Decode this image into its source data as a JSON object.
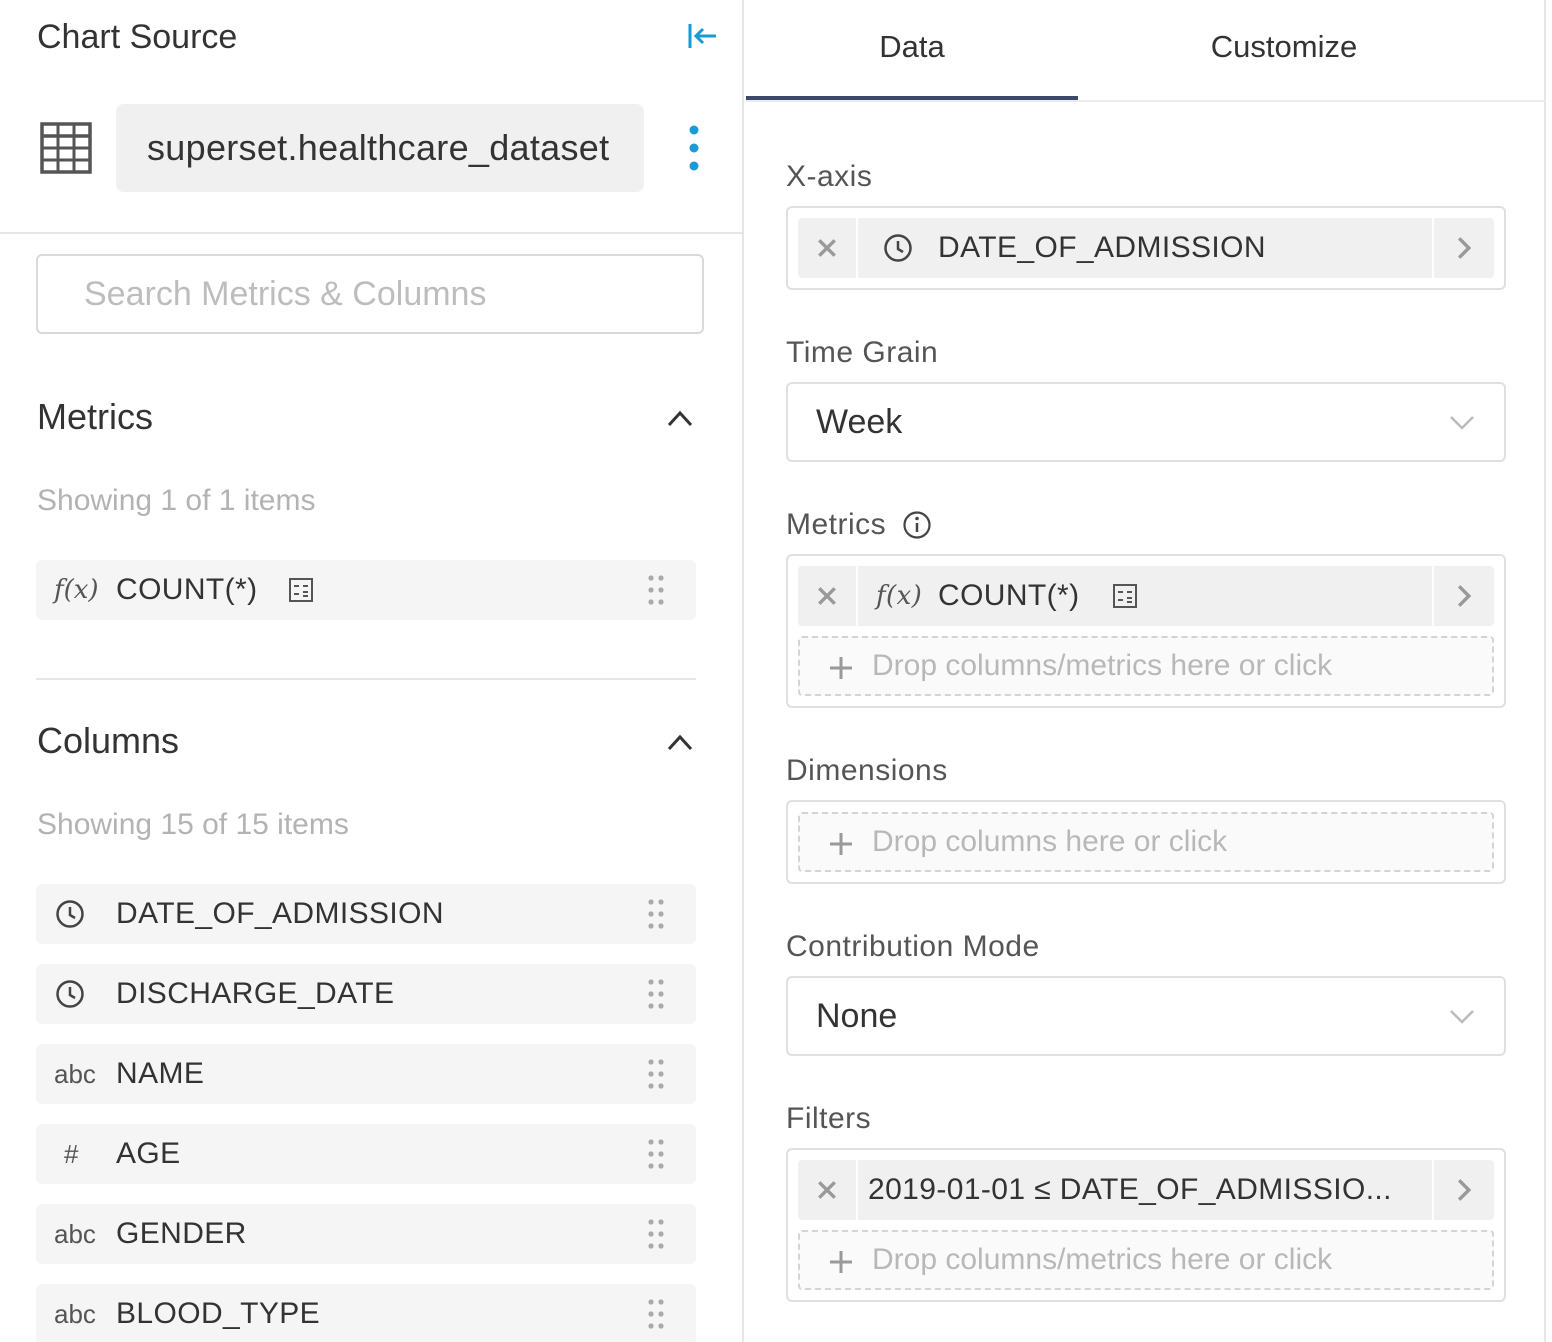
{
  "chart_source": {
    "title": "Chart Source",
    "dataset_name": "superset.healthcare_dataset",
    "search": {
      "placeholder": "Search Metrics & Columns",
      "value": ""
    },
    "metrics": {
      "title": "Metrics",
      "showing": "Showing 1 of 1 items",
      "items": [
        {
          "type_icon": "function-icon",
          "type_glyph": "f(x)",
          "label": "COUNT(*)"
        }
      ]
    },
    "columns": {
      "title": "Columns",
      "showing": "Showing 15 of 15 items",
      "items": [
        {
          "type_icon": "clock-icon",
          "label": "DATE_OF_ADMISSION"
        },
        {
          "type_icon": "clock-icon",
          "label": "DISCHARGE_DATE"
        },
        {
          "type_icon": "string-type-icon",
          "type_glyph": "abc",
          "label": "NAME"
        },
        {
          "type_icon": "numeric-type-icon",
          "type_glyph": "#",
          "label": "AGE"
        },
        {
          "type_icon": "string-type-icon",
          "type_glyph": "abc",
          "label": "GENDER"
        },
        {
          "type_icon": "string-type-icon",
          "type_glyph": "abc",
          "label": "BLOOD_TYPE"
        }
      ]
    }
  },
  "tabs": [
    {
      "label": "Data",
      "active": true
    },
    {
      "label": "Customize",
      "active": false
    }
  ],
  "controls": {
    "x_axis": {
      "label": "X-axis",
      "value": "DATE_OF_ADMISSION"
    },
    "time_grain": {
      "label": "Time Grain",
      "value": "Week"
    },
    "metrics": {
      "label": "Metrics",
      "value": "COUNT(*)",
      "fx_glyph": "f(x)",
      "drop_hint": "Drop columns/metrics here or click"
    },
    "dimensions": {
      "label": "Dimensions",
      "drop_hint": "Drop columns here or click"
    },
    "contribution_mode": {
      "label": "Contribution Mode",
      "value": "None"
    },
    "filters": {
      "label": "Filters",
      "value": "2019-01-01 ≤ DATE_OF_ADMISSIO...",
      "drop_hint": "Drop columns/metrics here or click"
    }
  },
  "colors": {
    "accent": "#1a9ad6",
    "tab_underline": "#3b4a6b",
    "chip_bg": "#f0f0f0",
    "muted_text": "#b3b3b3"
  }
}
